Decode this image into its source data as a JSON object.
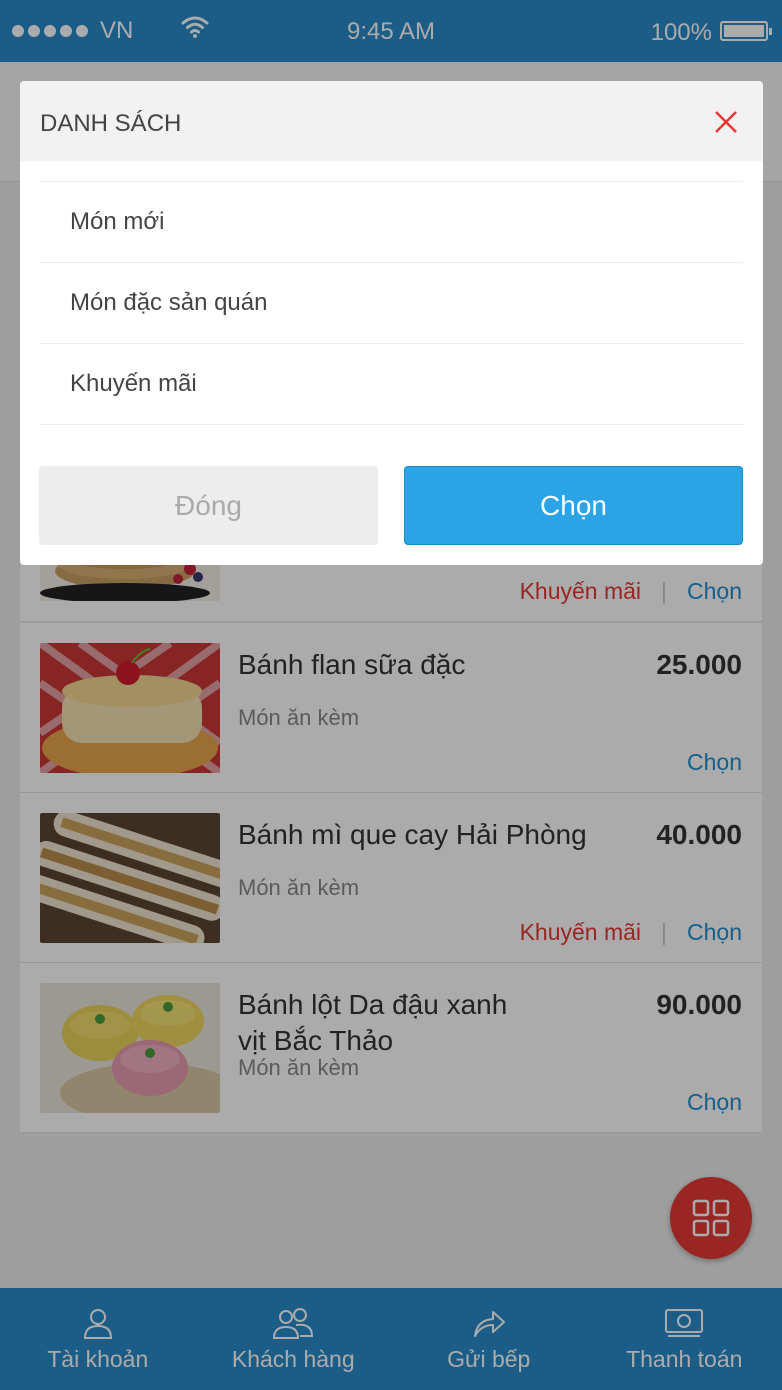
{
  "status_bar": {
    "carrier": "VN",
    "time": "9:45 AM",
    "battery": "100%"
  },
  "menu_items": [
    {
      "name": "",
      "category": "",
      "price": "",
      "promo": "Khuyến mãi",
      "choose": "Chọn"
    },
    {
      "name": "Bánh flan sữa đặc",
      "category": "Món ăn kèm",
      "price": "25.000",
      "promo": "",
      "choose": "Chọn"
    },
    {
      "name": "Bánh mì que cay Hải Phòng",
      "category": "Món ăn kèm",
      "price": "40.000",
      "promo": "Khuyến mãi",
      "choose": "Chọn"
    },
    {
      "name": "Bánh lột Da đậu xanh vịt Bắc Thảo",
      "category": "Món ăn kèm",
      "price": "90.000",
      "promo": "",
      "choose": "Chọn"
    }
  ],
  "bottom_nav": [
    {
      "label": "Tài khoản",
      "icon": "user-icon"
    },
    {
      "label": "Khách hàng",
      "icon": "users-icon"
    },
    {
      "label": "Gửi bếp",
      "icon": "share-icon"
    },
    {
      "label": "Thanh toán",
      "icon": "cash-icon"
    }
  ],
  "fab": {
    "icon": "grid-icon"
  },
  "modal": {
    "title": "DANH SÁCH",
    "options": [
      "Món mới",
      "Món đặc sản quán",
      "Khuyến mãi"
    ],
    "close_label": "Đóng",
    "choose_label": "Chọn"
  },
  "colors": {
    "primary": "#2a8bc9",
    "accent": "#2aa4e6",
    "danger": "#e53935"
  }
}
